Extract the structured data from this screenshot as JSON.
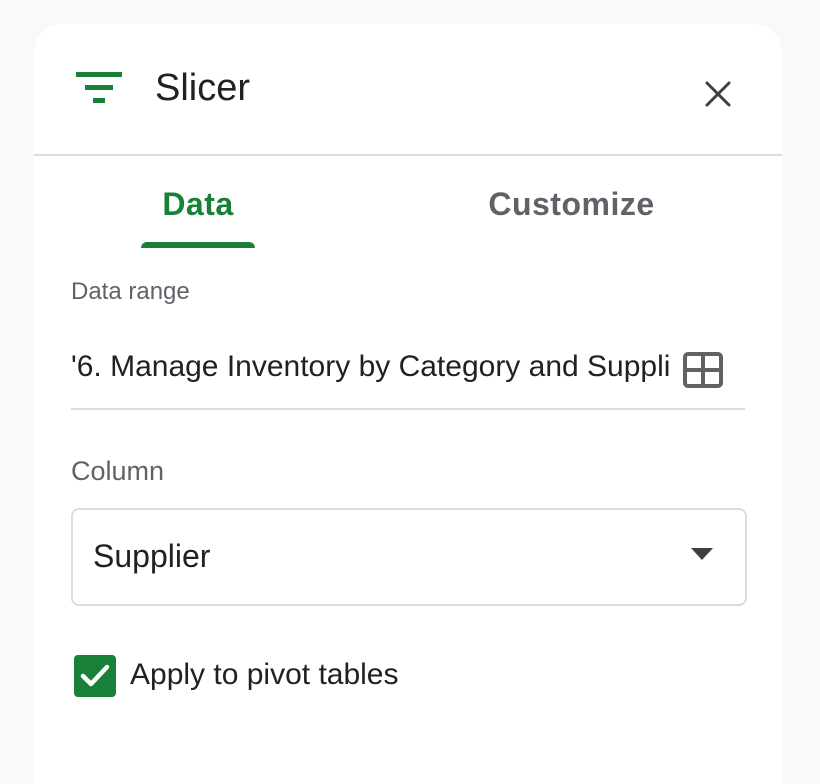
{
  "header": {
    "title": "Slicer",
    "icon": "filter-icon",
    "close_icon": "close-icon"
  },
  "tabs": [
    {
      "label": "Data",
      "active": true
    },
    {
      "label": "Customize",
      "active": false
    }
  ],
  "data_range": {
    "label": "Data range",
    "value": "'6. Manage Inventory by Category and Suppli",
    "icon": "grid-select-icon"
  },
  "column": {
    "label": "Column",
    "selected": "Supplier"
  },
  "pivot": {
    "label": "Apply to pivot tables",
    "checked": true
  },
  "colors": {
    "accent": "#188038",
    "text": "#202124",
    "muted": "#5f6368",
    "border": "#dadce0"
  }
}
